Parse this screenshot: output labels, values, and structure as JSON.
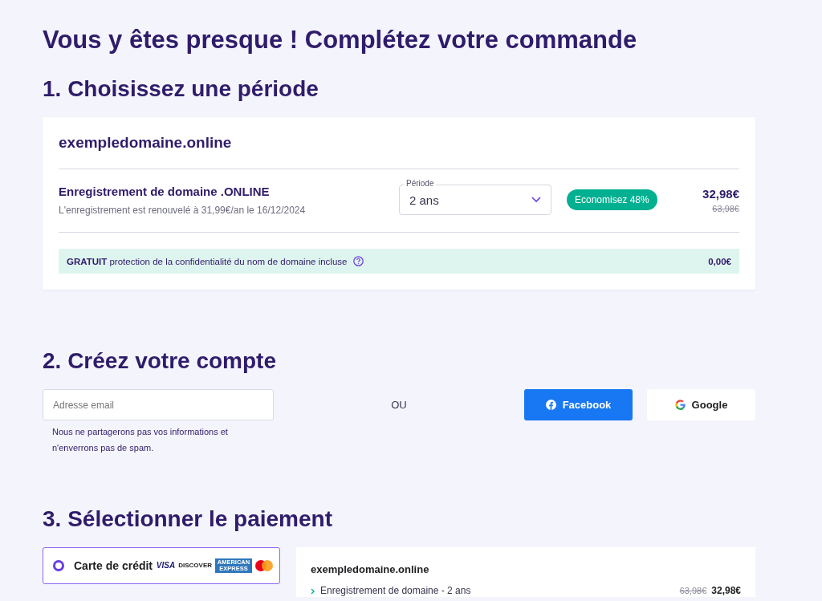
{
  "page_title": "Vous y êtes presque ! Complétez votre commande",
  "period_section": {
    "heading": "1. Choisissez une période",
    "domain": "exempledomaine.online",
    "item": {
      "name": "Enregistrement de domaine .ONLINE",
      "renewal": "L'enregistrement est renouvelé à 31,99€/an le 16/12/2024",
      "period_label": "Période",
      "period_value": "2 ans",
      "badge": "Economisez 48%",
      "price": "32,98€",
      "old_price": "63,98€"
    },
    "privacy": {
      "text": "**GRATUIT** protection de la confidentialité du nom de domaine incluse",
      "price": "0,00€"
    }
  },
  "account_section": {
    "heading": "2. Créez votre compte",
    "email_placeholder": "Adresse email",
    "note": "Nous ne partagerons pas vos informations et n'enverrons pas de spam.",
    "or": "OU",
    "buttons": [
      {
        "kind": "facebook",
        "label": "Facebook"
      },
      {
        "kind": "google",
        "label": "Google"
      }
    ]
  },
  "payment_section": {
    "heading": "3. Sélectionner le paiement",
    "methods": [
      {
        "label": "Carte de crédit",
        "selected": true,
        "brands": [
          "VISA",
          "DISCOVER",
          "AMERICAN EXPRESS"
        ]
      }
    ],
    "summary": {
      "domain": "exempledomaine.online",
      "rows": [
        {
          "name": "Enregistrement de domaine - 2 ans",
          "old_price": "63,98€",
          "price": "32,98€"
        }
      ]
    }
  }
}
